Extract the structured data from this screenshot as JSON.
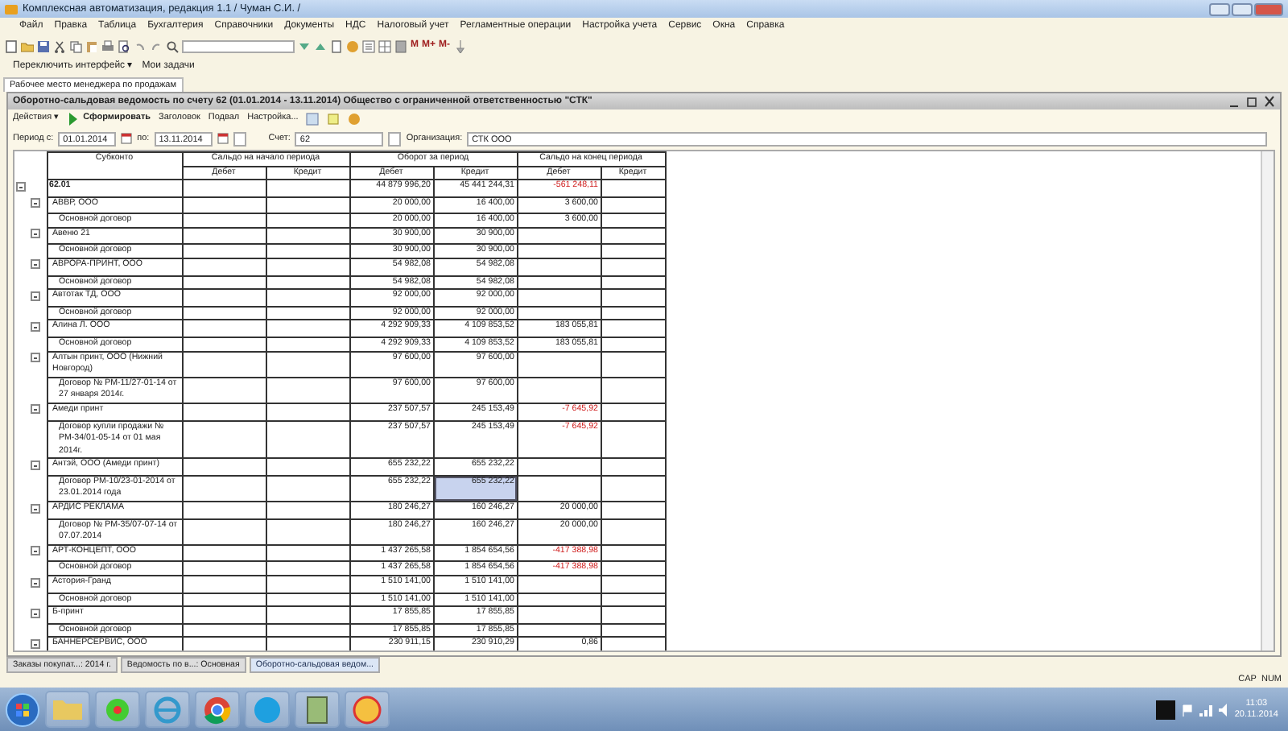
{
  "window": {
    "title": "Комплексная автоматизация, редакция 1.1 / Чуман С.И. /"
  },
  "menu": [
    "Файл",
    "Правка",
    "Таблица",
    "Бухгалтерия",
    "Справочники",
    "Документы",
    "НДС",
    "Налоговый учет",
    "Регламентные операции",
    "Настройка учета",
    "Сервис",
    "Окна",
    "Справка"
  ],
  "toolbar": {
    "memory_buttons": [
      "M",
      "M+",
      "M-"
    ]
  },
  "panel": {
    "buttons": [
      "Переключить интерфейс ▾",
      "Мои задачи"
    ]
  },
  "workspace_tab": {
    "label": "Рабочее место менеджера по продажам"
  },
  "document": {
    "title": "Оборотно-сальдовая ведомость по счету 62 (01.01.2014 - 13.11.2014) Общество с ограниченной ответственностью \"СТК\"",
    "actions": [
      {
        "label": "Действия ▾",
        "kind": "menu"
      },
      {
        "label": "Сформировать",
        "kind": "run"
      },
      {
        "label": "Заголовок",
        "kind": "plain"
      },
      {
        "label": "Подвал",
        "kind": "plain"
      },
      {
        "label": "Настройка...",
        "kind": "plain"
      }
    ],
    "filters": {
      "period_from_label": "Период с:",
      "period_from": "01.01.2014",
      "period_to_label": "по:",
      "period_to": "13.11.2014",
      "account_label": "Счет:",
      "account": "62",
      "organization_label": "Организация:",
      "organization": "СТК ООО"
    }
  },
  "report": {
    "columns": [
      {
        "title": "Субконто"
      },
      {
        "title": "Сальдо на начало периода",
        "sub": [
          "Дебет",
          "Кредит"
        ]
      },
      {
        "title": "Оборот за период",
        "sub": [
          "Дебет",
          "Кредит"
        ]
      },
      {
        "title": "Сальдо на конец периода",
        "sub": [
          "Дебет",
          "Кредит"
        ]
      }
    ],
    "rows": [
      {
        "subconto": "62.01",
        "turnover_debit": "44 879 996,20",
        "turnover_credit": "45 441 244,31",
        "closing_debit": "-561 248,11",
        "negative": true,
        "selected": false,
        "expanded": true,
        "children": [
          {
            "subconto": "АВВР, ООО",
            "turnover_debit": "20 000,00",
            "turnover_credit": "16 400,00",
            "closing_debit": "3 600,00",
            "negative": false,
            "selected": false,
            "expanded": true,
            "children": [
              {
                "subconto": "Основной договор",
                "turnover_debit": "20 000,00",
                "turnover_credit": "16 400,00",
                "closing_debit": "3 600,00",
                "negative": false,
                "selected": false
              }
            ]
          },
          {
            "subconto": "Авеню 21",
            "turnover_debit": "30 900,00",
            "turnover_credit": "30 900,00",
            "selected": false,
            "expanded": true,
            "children": [
              {
                "subconto": "Основной договор",
                "turnover_debit": "30 900,00",
                "turnover_credit": "30 900,00",
                "selected": false
              }
            ]
          },
          {
            "subconto": "АВРОРА-ПРИНТ, ООО",
            "turnover_debit": "54 982,08",
            "turnover_credit": "54 982,08",
            "selected": false,
            "expanded": true,
            "children": [
              {
                "subconto": "Основной договор",
                "turnover_debit": "54 982,08",
                "turnover_credit": "54 982,08",
                "selected": false
              }
            ]
          },
          {
            "subconto": "Автотак ТД, ООО",
            "turnover_debit": "92 000,00",
            "turnover_credit": "92 000,00",
            "selected": false,
            "expanded": true,
            "children": [
              {
                "subconto": "Основной договор",
                "turnover_debit": "92 000,00",
                "turnover_credit": "92 000,00",
                "selected": false
              }
            ]
          },
          {
            "subconto": "Алина Л. ООО",
            "turnover_debit": "4 292 909,33",
            "turnover_credit": "4 109 853,52",
            "closing_debit": "183 055,81",
            "negative": false,
            "selected": false,
            "expanded": true,
            "children": [
              {
                "subconto": "Основной договор",
                "turnover_debit": "4 292 909,33",
                "turnover_credit": "4 109 853,52",
                "closing_debit": "183 055,81",
                "negative": false,
                "selected": false
              }
            ]
          },
          {
            "subconto": "Алтын принт, ООО (Нижний Новгород)",
            "turnover_debit": "97 600,00",
            "turnover_credit": "97 600,00",
            "selected": false,
            "expanded": true,
            "children": [
              {
                "subconto": "Договор № РМ-11/27-01-14 от 27 января 2014г.",
                "turnover_debit": "97 600,00",
                "turnover_credit": "97 600,00",
                "selected": false
              }
            ]
          },
          {
            "subconto": "Амеди принт",
            "turnover_debit": "237 507,57",
            "turnover_credit": "245 153,49",
            "closing_debit": "-7 645,92",
            "negative": true,
            "selected": false,
            "expanded": true,
            "children": [
              {
                "subconto": "Договор купли продажи № РМ-34/01-05-14 от 01 мая 2014г.",
                "turnover_debit": "237 507,57",
                "turnover_credit": "245 153,49",
                "closing_debit": "-7 645,92",
                "negative": true,
                "selected": false
              }
            ]
          },
          {
            "subconto": "Антэй, ООО (Амеди принт)",
            "turnover_debit": "655 232,22",
            "turnover_credit": "655 232,22",
            "selected": false,
            "expanded": true,
            "children": [
              {
                "subconto": "Договор РМ-10/23-01-2014 от 23.01.2014 года",
                "turnover_debit": "655 232,22",
                "turnover_credit": "655 232,22",
                "selected": true
              }
            ]
          },
          {
            "subconto": "АРДИС РЕКЛАМА",
            "turnover_debit": "180 246,27",
            "turnover_credit": "160 246,27",
            "closing_debit": "20 000,00",
            "negative": false,
            "selected": false,
            "expanded": true,
            "children": [
              {
                "subconto": "Договор № РМ-35/07-07-14 от 07.07.2014",
                "turnover_debit": "180 246,27",
                "turnover_credit": "160 246,27",
                "closing_debit": "20 000,00",
                "negative": false,
                "selected": false
              }
            ]
          },
          {
            "subconto": "АРТ-КОНЦЕПТ, ООО",
            "turnover_debit": "1 437 265,58",
            "turnover_credit": "1 854 654,56",
            "closing_debit": "-417 388,98",
            "negative": true,
            "selected": false,
            "expanded": true,
            "children": [
              {
                "subconto": "Основной договор",
                "turnover_debit": "1 437 265,58",
                "turnover_credit": "1 854 654,56",
                "closing_debit": "-417 388,98",
                "negative": true,
                "selected": false
              }
            ]
          },
          {
            "subconto": "Астория-Гранд",
            "turnover_debit": "1 510 141,00",
            "turnover_credit": "1 510 141,00",
            "selected": false,
            "expanded": true,
            "children": [
              {
                "subconto": "Основной договор",
                "turnover_debit": "1 510 141,00",
                "turnover_credit": "1 510 141,00",
                "selected": false
              }
            ]
          },
          {
            "subconto": "Б-принт",
            "turnover_debit": "17 855,85",
            "turnover_credit": "17 855,85",
            "selected": false,
            "expanded": true,
            "children": [
              {
                "subconto": "Основной договор",
                "turnover_debit": "17 855,85",
                "turnover_credit": "17 855,85",
                "selected": false
              }
            ]
          },
          {
            "subconto": "БАННЕРСЕРВИС, ООО",
            "turnover_debit": "230 911,15",
            "turnover_credit": "230 910,29",
            "closing_debit": "0,86",
            "negative": false,
            "selected": false,
            "expanded": true
          }
        ]
      }
    ]
  },
  "window_tabs": [
    {
      "label": "Заказы покупат...: 2014 г.",
      "selected": false
    },
    {
      "label": "Ведомость по в...: Основная",
      "selected": false
    },
    {
      "label": "Оборотно-сальдовая ведом...",
      "selected": true
    }
  ],
  "status_bar": [
    "CAP",
    "NUM"
  ],
  "taskbar": {
    "time": "11:03",
    "date": "20.11.2014"
  }
}
